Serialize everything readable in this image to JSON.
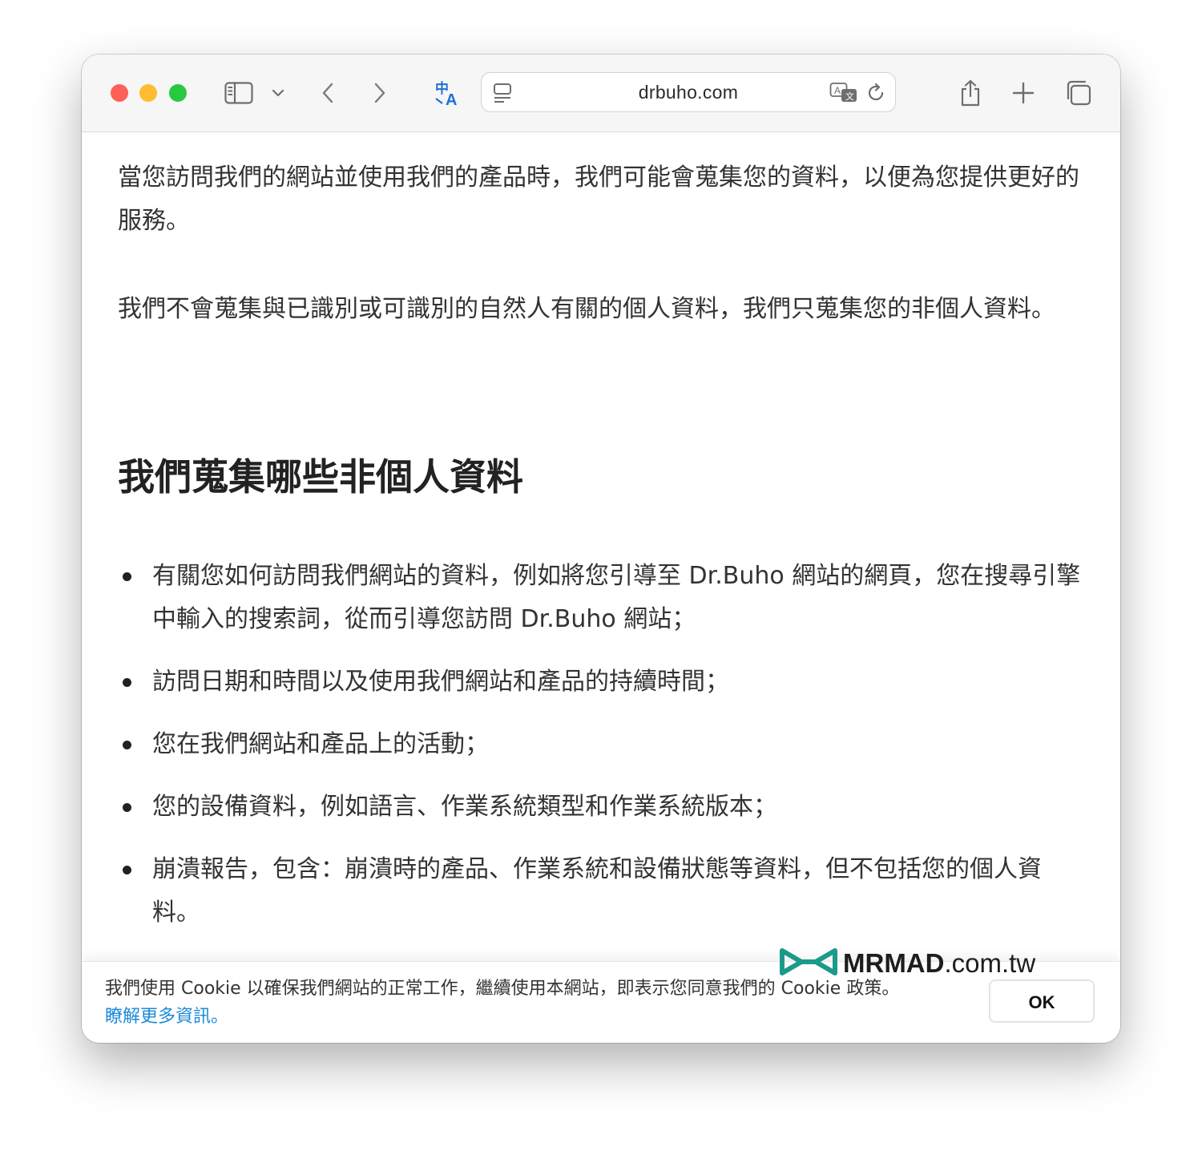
{
  "browser": {
    "address": "drbuho.com",
    "traffic_lights": {
      "close": "#fe5f57",
      "minimize": "#febc2e",
      "zoom": "#28c840"
    },
    "icons": [
      "sidebar-icon",
      "chevron-down-icon",
      "back-icon",
      "forward-icon",
      "translate-icon",
      "reader-icon",
      "translate-bubble-icon",
      "reload-icon",
      "share-icon",
      "plus-icon",
      "tabs-icon"
    ]
  },
  "article": {
    "paragraphs": [
      "當您訪問我們的網站並使用我們的產品時，我們可能會蒐集您的資料，以便為您提供更好的服務。",
      "我們不會蒐集與已識別或可識別的自然人有關的個人資料，我們只蒐集您的非個人資料。"
    ],
    "heading": "我們蒐集哪些非個人資料",
    "bullets": [
      "有關您如何訪問我們網站的資料，例如將您引導至 Dr.Buho 網站的網頁，您在搜尋引擎中輸入的搜索詞，從而引導您訪問 Dr.Buho 網站；",
      "訪問日期和時間以及使用我們網站和產品的持續時間；",
      "您在我們網站和產品上的活動；",
      "您的設備資料，例如語言、作業系統類型和作業系統版本；",
      "崩潰報告，包含：崩潰時的產品、作業系統和設備狀態等資料，但不包括您的個人資料。"
    ]
  },
  "cookie_banner": {
    "text": "我們使用 Cookie 以確保我們網站的正常工作，繼續使用本網站，即表示您同意我們的 Cookie 政策。",
    "link": "瞭解更多資訊。",
    "button": "OK",
    "link_color": "#1a8ad8"
  },
  "watermark": {
    "brand": "MRMAD",
    "suffix": ".com.tw",
    "color": "#1a9a8a"
  }
}
